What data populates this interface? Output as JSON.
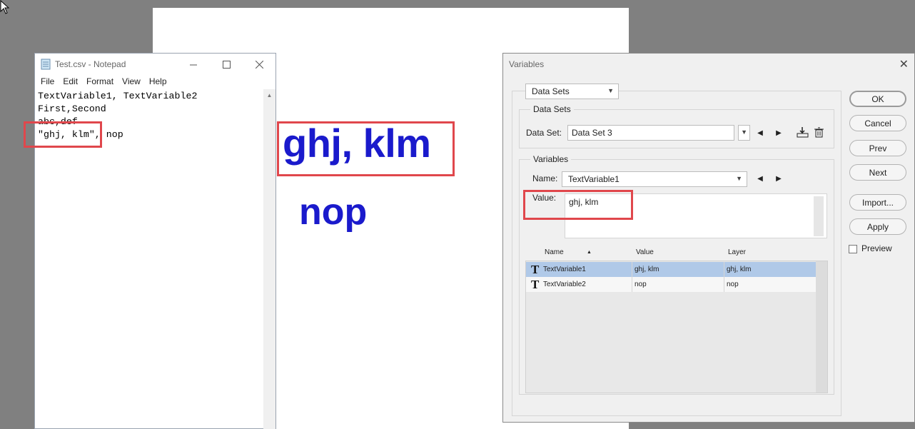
{
  "canvas": {
    "line1": "ghj, klm",
    "line2": "nop",
    "text_color": "#1a1acc"
  },
  "notepad": {
    "title": "Test.csv - Notepad",
    "menu": [
      "File",
      "Edit",
      "Format",
      "View",
      "Help"
    ],
    "lines": [
      "TextVariable1, TextVariable2",
      "First,Second",
      "abc,def",
      "\"ghj, klm\", nop"
    ]
  },
  "dialog": {
    "title": "Variables",
    "mode_select": "Data Sets",
    "data_sets_group": "Data Sets",
    "data_set_label": "Data Set:",
    "data_set_value": "Data Set 3",
    "variables_group": "Variables",
    "name_label": "Name:",
    "name_value": "TextVariable1",
    "value_label": "Value:",
    "value_text": "ghj, klm",
    "table": {
      "headers": [
        "Name",
        "Value",
        "Layer"
      ],
      "rows": [
        {
          "name": "TextVariable1",
          "value": "ghj, klm",
          "layer": "ghj, klm",
          "selected": true
        },
        {
          "name": "TextVariable2",
          "value": "nop",
          "layer": "nop",
          "selected": false
        }
      ]
    },
    "buttons": {
      "ok": "OK",
      "cancel": "Cancel",
      "prev": "Prev",
      "next": "Next",
      "import": "Import...",
      "apply": "Apply"
    },
    "preview_label": "Preview",
    "highlight_color": "#e0474c"
  }
}
